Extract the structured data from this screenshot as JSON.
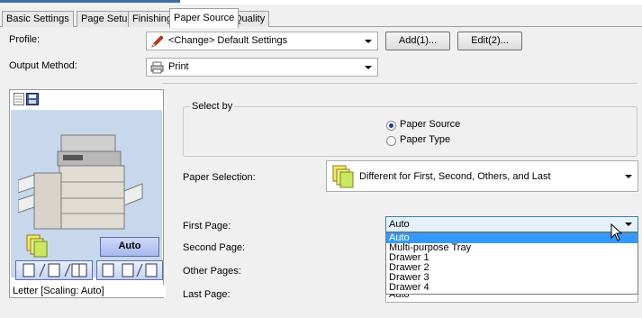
{
  "tabs": [
    {
      "label": "Basic Settings"
    },
    {
      "label": "Page Setup"
    },
    {
      "label": "Finishing"
    },
    {
      "label": "Paper Source",
      "active": true
    },
    {
      "label": "Quality"
    }
  ],
  "profile": {
    "label": "Profile:",
    "value": "<Change> Default Settings",
    "add_button": "Add(1)...",
    "edit_button": "Edit(2)..."
  },
  "output_method": {
    "label": "Output Method:",
    "value": "Print"
  },
  "preview": {
    "auto_label": "Auto",
    "status_text": "Letter [Scaling: Auto]"
  },
  "select_by": {
    "title": "Select by",
    "options": [
      {
        "label": "Paper Source",
        "selected": true
      },
      {
        "label": "Paper Type",
        "selected": false
      }
    ]
  },
  "paper_selection": {
    "label": "Paper Selection:",
    "value": "Different for First, Second, Others, and Last"
  },
  "pages": {
    "first_label": "First Page:",
    "first_value": "Auto",
    "second_label": "Second Page:",
    "others_label": "Other Pages:",
    "last_label": "Last Page:",
    "last_value": "Auto"
  },
  "dropdown": {
    "options": [
      "Auto",
      "Multi-purpose Tray",
      "Drawer 1",
      "Drawer 2",
      "Drawer 3",
      "Drawer 4"
    ],
    "highlighted": "Auto"
  },
  "colors": {
    "accent": "#3399ff",
    "preview_bg": "#c8d8ec"
  }
}
